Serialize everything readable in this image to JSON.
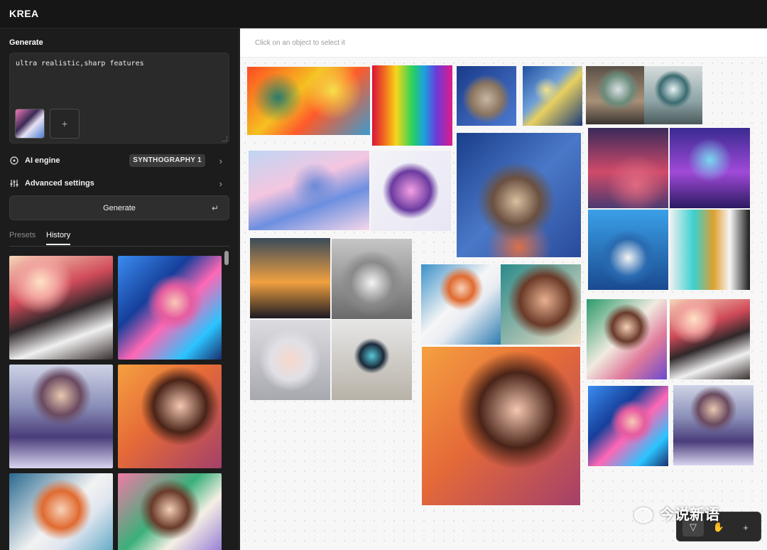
{
  "app": {
    "brand": "KREA"
  },
  "sidebar": {
    "section_title": "Generate",
    "prompt_value": "ultra realistic,sharp features",
    "add_reference_symbol": "+",
    "ai_engine": {
      "label": "AI engine",
      "value": "SYNTHOGRAPHY 1"
    },
    "advanced_settings": {
      "label": "Advanced settings"
    },
    "generate_button": {
      "label": "Generate",
      "shortcut_symbol": "↵"
    },
    "tabs": [
      {
        "label": "Presets",
        "active": false
      },
      {
        "label": "History",
        "active": true
      }
    ],
    "history_items": [
      "anime girl with guitar",
      "cyber anime face",
      "anime girl with wings",
      "curly hair woman portrait",
      "anime girl with paint splash",
      "anime girl in green jacket"
    ]
  },
  "canvas": {
    "hint": "Click on an object to select it",
    "images": [
      "abstract fluid map",
      "rainbow jacket",
      "tabby kitten",
      "starry night swirl",
      "futuristic lounge",
      "porthole bedroom",
      "pastel marble swirl",
      "galaxy coat",
      "cat on starry night",
      "neon bedroom",
      "blue bedroom",
      "blue office",
      "teal kitchen",
      "curved architecture",
      "modern house",
      "white pavilion",
      "cyber dome",
      "anime girl",
      "woman portrait",
      "curly hair woman portrait",
      "anime girl with petals",
      "anime girl with guitar",
      "cyber anime face",
      "anime girl with wings"
    ]
  },
  "toolbar": {
    "tools": [
      {
        "name": "select",
        "symbol": "▽",
        "active": true
      },
      {
        "name": "pan",
        "symbol": "✋",
        "active": false
      },
      {
        "name": "add",
        "symbol": "+",
        "active": false
      }
    ]
  },
  "watermark": {
    "text": "今说新语"
  },
  "colors": {
    "sidebar_bg": "#1c1c1c",
    "canvas_bg": "#f7f7f7",
    "topbar_bg": "#161616"
  }
}
